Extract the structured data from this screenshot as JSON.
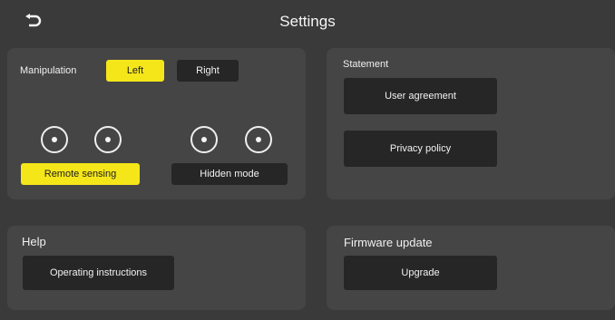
{
  "header": {
    "title": "Settings",
    "back_icon": "back-arrow-icon"
  },
  "manipulation": {
    "label": "Manipulation",
    "left_label": "Left",
    "right_label": "Right",
    "selected": "Left",
    "modes": [
      {
        "label": "Remote sensing",
        "active": true
      },
      {
        "label": "Hidden mode",
        "active": false
      }
    ]
  },
  "statement": {
    "label": "Statement",
    "user_agreement_label": "User agreement",
    "privacy_policy_label": "Privacy policy"
  },
  "help": {
    "label": "Help",
    "instructions_label": "Operating instructions"
  },
  "firmware": {
    "label": "Firmware update",
    "upgrade_label": "Upgrade"
  },
  "colors": {
    "background": "#3a3a3a",
    "panel": "#454545",
    "button": "#262626",
    "accent": "#f5e61a"
  }
}
